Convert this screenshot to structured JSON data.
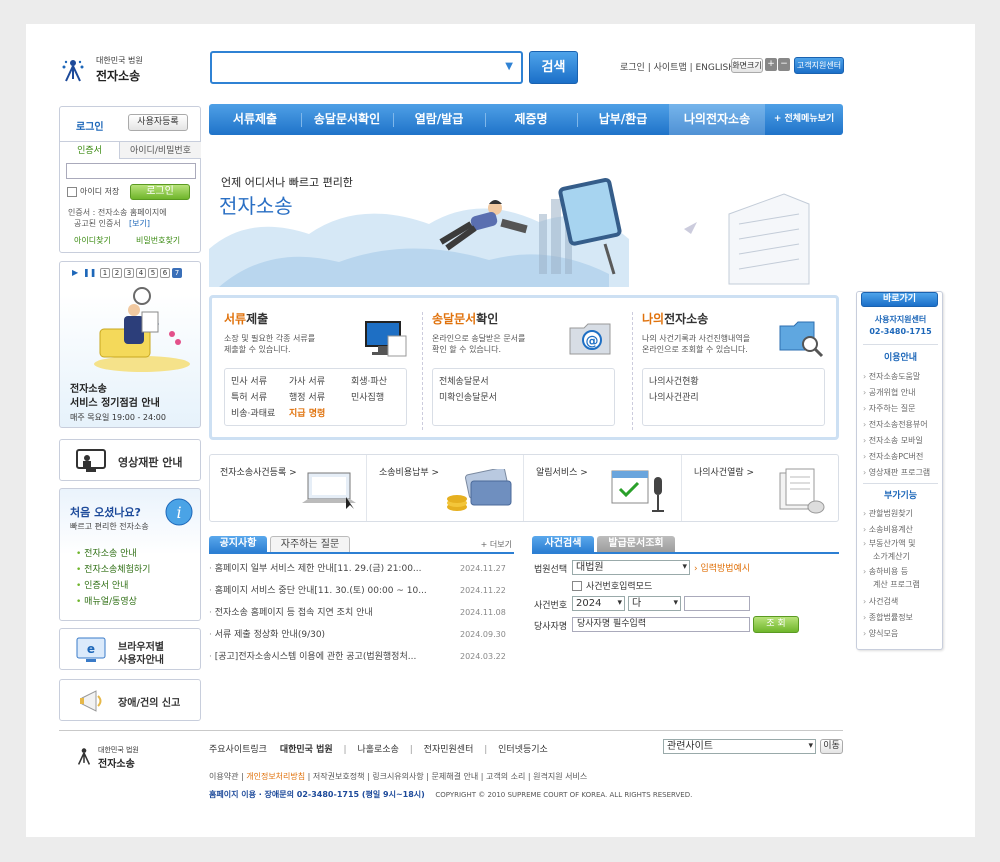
{
  "logo": {
    "org": "대한민국 법원",
    "name": "전자소송"
  },
  "search": {
    "button": "검색",
    "value": ""
  },
  "top_links": {
    "login": "로그인",
    "sitemap": "사이트맵",
    "english": "ENGLISH",
    "zoom": "화면크기",
    "plus": "+",
    "minus": "−",
    "support": "고객지원센터"
  },
  "nav": {
    "items": [
      "서류제출",
      "송달문서확인",
      "열람/발급",
      "제증명",
      "납부/환급",
      "나의전자소송"
    ],
    "all_menu": "+ 전체메뉴보기"
  },
  "login_box": {
    "login_label": "로그인",
    "register": "사용자등록",
    "tab_cert": "인증서",
    "tab_id": "아이디/비밀번호",
    "save_id": "아이디 저장",
    "login_button": "로그인",
    "notice_1": "인증서 : 전자소송 홈페이지에",
    "notice_2": "공고된 인증서",
    "notice_link": "[보기]",
    "find_id": "아이디찾기",
    "find_pw": "비밀번호찾기"
  },
  "banner_left": {
    "pages": [
      "1",
      "2",
      "3",
      "4",
      "5",
      "6",
      "7"
    ],
    "title1": "전자소송",
    "title2": "서비스 정기점검 안내",
    "time": "매주 목요일 19:00 - 24:00"
  },
  "video_trial": {
    "label": "영상재판 안내"
  },
  "first_visit": {
    "title": "처음 오셨나요?",
    "subtitle": "빠르고 편리한 전자소송",
    "links": [
      "전자소송 안내",
      "전자소송체험하기",
      "인증서 안내",
      "매뉴얼/동영상"
    ]
  },
  "browser_guide": {
    "line1": "브라우저별",
    "line2": "사용자안내"
  },
  "fault_report": {
    "label": "장애/건의 신고"
  },
  "hero": {
    "tagline": "언제 어디서나 빠르고 편리한",
    "title": "전자소송"
  },
  "services": [
    {
      "hl": "서류",
      "rest": "제출",
      "desc1": "소장 및 필요한 각종 서류를",
      "desc2": "제출할 수 있습니다.",
      "rows": [
        [
          "민사 서류",
          "가사 서류",
          "회생·파산"
        ],
        [
          "특허 서류",
          "행정 서류",
          "민사집행"
        ],
        [
          "비송·과태료",
          "지급 명령",
          ""
        ]
      ]
    },
    {
      "hl": "송달문서",
      "rest": "확인",
      "desc1": "온라인으로 송달받은 문서를",
      "desc2": "확인 할 수 있습니다.",
      "rows": [
        [
          "전체송달문서"
        ],
        [
          "미확인송달문서"
        ]
      ]
    },
    {
      "hl": "나의",
      "rest": "전자소송",
      "desc1": "나의 사건기록과 사건진행내역을",
      "desc2": "온라인으로 조회할 수 있습니다.",
      "rows": [
        [
          "나의사건현황"
        ],
        [
          "나의사건관리"
        ]
      ]
    }
  ],
  "quick": [
    "전자소송사건등록 >",
    "소송비용납부 >",
    "알림서비스 >",
    "나의사건열람 >"
  ],
  "notice": {
    "tab_on": "공지사항",
    "tab_off": "자주하는 질문",
    "more": "+ 더보기",
    "items": [
      {
        "title": "홈페이지 일부 서비스 제한 안내[11. 29.(금) 21:00...",
        "date": "2024.11.27"
      },
      {
        "title": "홈페이지 서비스 중단 안내[11. 30.(토) 00:00 ~ 10...",
        "date": "2024.11.22"
      },
      {
        "title": "전자소송 홈페이지 등 접속 지연 조치 안내",
        "date": "2024.11.08"
      },
      {
        "title": "서류 제출 정상화 안내(9/30)",
        "date": "2024.09.30"
      },
      {
        "title": "[공고]전자소송시스템 이용에 관한 공고(법원행정처...",
        "date": "2024.03.22"
      }
    ]
  },
  "case_search": {
    "tab_on": "사건검색",
    "tab_off": "발급문서조회",
    "court_label": "법원선택",
    "court_value": "대법원",
    "input_help": "입력방법예시",
    "mode": "사건번호입력모드",
    "caseno_label": "사건번호",
    "year": "2024",
    "type": "다",
    "party_label": "당사자명",
    "party_placeholder": "당사자명 필수입력",
    "button": "조 회"
  },
  "right_panel": {
    "title": "바로가기",
    "center": "사용자지원센터",
    "phone": "02-3480-1715",
    "sec1": "이용안내",
    "links1": [
      "전자소송도움말",
      "공개위협 안내",
      "자주하는 질문",
      "전자소송전용뷰어",
      "전자소송 모바일",
      "전자소송PC버전",
      "영상재판 프로그램"
    ],
    "sec2": "부가기능",
    "links2": [
      "관할법원찾기",
      "소송비용계산",
      "부동산가액 및",
      "소가계산기",
      "송하비용 등",
      "계산 프로그램",
      "사건검색",
      "종합법률정보",
      "양식모음"
    ]
  },
  "footer": {
    "logo_org": "대한민국 법원",
    "logo_name": "전자소송",
    "label": "주요사이트링크",
    "sites": [
      "대한민국 법원",
      "나홀로소송",
      "전자민원센터",
      "인터넷등기소"
    ],
    "related": "관련사이트",
    "go": "이동",
    "links": [
      "이용약관",
      "개인정보처리방침",
      "저작권보호정책",
      "링크시유의사항",
      "문제해결 안내",
      "고객의 소리",
      "원격지원 서비스"
    ],
    "contact": "홈페이지 이용 · 장애문의 02-3480-1715 (평일 9시~18시)",
    "copyright": "COPYRIGHT © 2010 SUPREME COURT OF KOREA. ALL RIGHTS RESERVED."
  },
  "colors": {
    "accent": "#2c7fd3",
    "green": "#6fb52b",
    "orange": "#e0720c"
  }
}
